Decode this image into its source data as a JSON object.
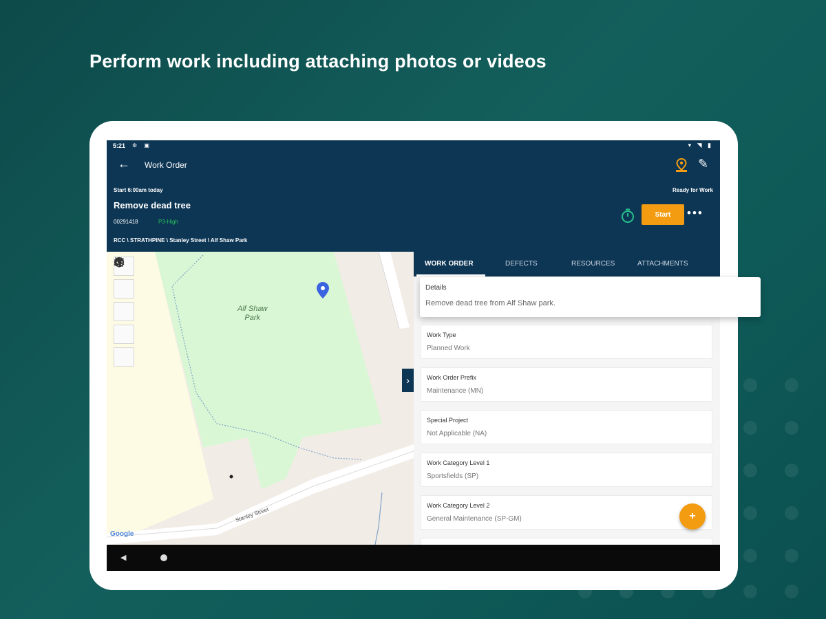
{
  "headline": "Perform work including attaching photos or videos",
  "status_bar": {
    "time": "5:21"
  },
  "app_bar": {
    "title": "Work Order",
    "start_time": "Start 6:00am today",
    "status": "Ready for Work",
    "work_order_title": "Remove dead tree",
    "work_order_number": "00291418",
    "priority": "P3-High",
    "start_button": "Start",
    "more_label": "•••",
    "location_path": "RCC \\ STRATHPINE \\ Stanley Street \\ Alf Shaw Park"
  },
  "map": {
    "park_label_line1": "Alf Shaw",
    "park_label_line2": "Park",
    "street_label": "Stanley Street",
    "attribution": "Google",
    "collapse_label": "›"
  },
  "tabs": [
    {
      "label": "WORK ORDER",
      "active": true
    },
    {
      "label": "DEFECTS",
      "active": false
    },
    {
      "label": "RESOURCES",
      "active": false
    },
    {
      "label": "ATTACHMENTS",
      "active": false
    }
  ],
  "details": {
    "label": "Details",
    "value": "Remove dead tree from Alf Shaw park."
  },
  "fields": [
    {
      "label": "Work Type",
      "value": "Planned Work"
    },
    {
      "label": "Work Order Prefix",
      "value": "Maintenance (MN)"
    },
    {
      "label": "Special Project",
      "value": "Not Applicable (NA)"
    },
    {
      "label": "Work Category Level 1",
      "value": "Sportsfields (SP)"
    },
    {
      "label": "Work Category Level 2",
      "value": "General Maintenance (SP-GM)"
    }
  ],
  "fab_label": "+",
  "colors": {
    "appbar": "#0d3655",
    "accent": "#f39c12",
    "priority": "#27c25a",
    "background": "#135f5c"
  }
}
